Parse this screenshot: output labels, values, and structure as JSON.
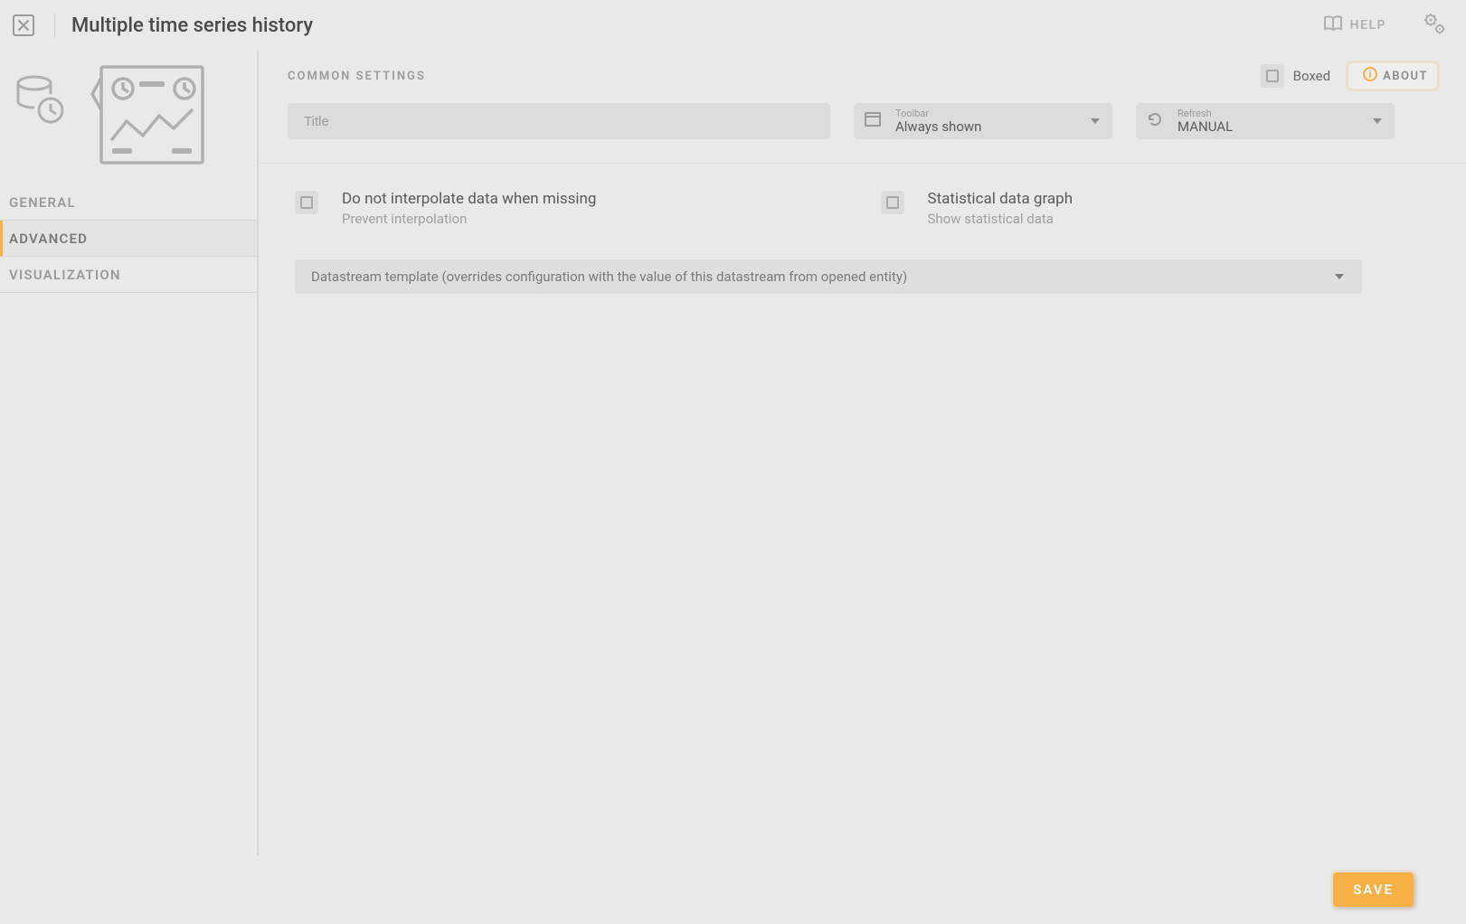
{
  "header": {
    "title": "Multiple time series history",
    "help_label": "HELP"
  },
  "sidebar": {
    "items": [
      {
        "label": "GENERAL"
      },
      {
        "label": "ADVANCED"
      },
      {
        "label": "VISUALIZATION"
      }
    ]
  },
  "common": {
    "section_title": "COMMON SETTINGS",
    "boxed_label": "Boxed",
    "about_label": "ABOUT",
    "title_placeholder": "Title",
    "title_value": "",
    "toolbar": {
      "label": "Toolbar",
      "value": "Always shown"
    },
    "refresh": {
      "label": "Refresh",
      "value": "MANUAL"
    }
  },
  "advanced": {
    "options": [
      {
        "title": "Do not interpolate data when missing",
        "subtitle": "Prevent interpolation"
      },
      {
        "title": "Statistical data graph",
        "subtitle": "Show statistical data"
      }
    ],
    "datastream_placeholder": "Datastream template (overrides configuration with the value of this datastream from opened entity)"
  },
  "footer": {
    "save_label": "SAVE"
  }
}
